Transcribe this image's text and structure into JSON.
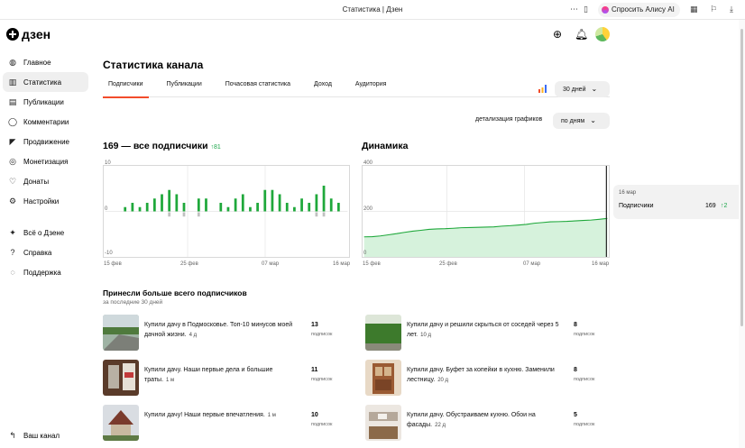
{
  "browser": {
    "tab_title": "Статистика | Дзен",
    "alice_label": "Спросить Алису AI"
  },
  "header": {
    "logo_text": "дзен"
  },
  "sidebar": {
    "items": [
      {
        "label": "Главное",
        "icon": "planet-icon"
      },
      {
        "label": "Статистика",
        "icon": "bars-icon"
      },
      {
        "label": "Публикации",
        "icon": "document-icon"
      },
      {
        "label": "Комментарии",
        "icon": "comment-icon"
      },
      {
        "label": "Продвижение",
        "icon": "megaphone-icon"
      },
      {
        "label": "Монетизация",
        "icon": "coin-icon"
      },
      {
        "label": "Донаты",
        "icon": "heart-hand-icon"
      },
      {
        "label": "Настройки",
        "icon": "gear-icon"
      },
      {
        "label": "Всё о Дзене",
        "icon": "dzen-logo-icon"
      },
      {
        "label": "Справка",
        "icon": "question-icon"
      },
      {
        "label": "Поддержка",
        "icon": "chat-icon"
      }
    ],
    "back_label": "Ваш канал"
  },
  "page": {
    "title": "Статистика канала",
    "tabs": [
      "Подписчики",
      "Публикации",
      "Почасовая статистика",
      "Доход",
      "Аудитория"
    ],
    "period": "30 дней",
    "detail_label": "детализация графиков",
    "detail_value": "по дням"
  },
  "chart_left": {
    "title": "169 — все подписчики",
    "delta": "81",
    "y_ticks": [
      "10",
      "0",
      "-10"
    ],
    "x_ticks": [
      "15 фев",
      "25 фев",
      "07 мар",
      "16 мар"
    ]
  },
  "chart_right": {
    "title": "Динамика",
    "y_ticks": [
      "400",
      "200",
      "0"
    ],
    "x_ticks": [
      "15 фев",
      "25 фев",
      "07 мар",
      "16 мар"
    ]
  },
  "chart_data": [
    {
      "type": "bar",
      "ylim": [
        -10,
        10
      ],
      "x": [
        "15 фев",
        "",
        "",
        "",
        "",
        "",
        "",
        "",
        "",
        "",
        "25 фев",
        "",
        "",
        "",
        "",
        "",
        "",
        "",
        "",
        "",
        "07 мар",
        "",
        "",
        "",
        "",
        "",
        "",
        "",
        "",
        "",
        "16 мар"
      ],
      "series": [
        {
          "color": "#1fa83b",
          "values": [
            0,
            1,
            2,
            1,
            2,
            3,
            4,
            5,
            4,
            2,
            0,
            3,
            3,
            0,
            2,
            1,
            3,
            4,
            1,
            2,
            5,
            5,
            4,
            2,
            1,
            3,
            2,
            4,
            6,
            3,
            2
          ]
        },
        {
          "color": "#c0c0c0",
          "values": [
            0,
            0,
            0,
            0,
            0,
            0,
            0,
            -1,
            0,
            -1,
            0,
            -1,
            0,
            0,
            0,
            0,
            0,
            0,
            0,
            0,
            0,
            0,
            0,
            0,
            0,
            0,
            0,
            -1,
            -1,
            0,
            0
          ]
        }
      ],
      "grid": true
    },
    {
      "type": "area",
      "ylim": [
        0,
        400
      ],
      "x": [
        "15 фев",
        "25 фев",
        "07 мар",
        "16 мар"
      ],
      "series": [
        {
          "color": "#1fa83b",
          "values": [
            88,
            89,
            92,
            97,
            102,
            108,
            113,
            117,
            121,
            123,
            124,
            126,
            128,
            129,
            130,
            131,
            132,
            135,
            137,
            140,
            143,
            148,
            151,
            154,
            155,
            156,
            158,
            160,
            162,
            165,
            169
          ]
        }
      ],
      "grid": true
    }
  ],
  "hover": {
    "date": "16 мар",
    "name": "Подписчики",
    "value": "169",
    "delta": "2"
  },
  "top_section": {
    "title": "Принесли больше всего подписчиков",
    "subtitle": "за последние 30 дней",
    "unit": "подписок",
    "items": [
      {
        "title": "Купили дачу в Подмосковье. Топ-10 минусов моей дачной жизни.",
        "age": "4 д",
        "count": "13"
      },
      {
        "title": "Купили дачу и решили скрыться от соседей через 5 лет.",
        "age": "10 д",
        "count": "8"
      },
      {
        "title": "Купили дачу. Наши первые дела и большие траты.",
        "age": "1 м",
        "count": "11"
      },
      {
        "title": "Купили дачу. Буфет за копейки в кухню. Заменили лестницу.",
        "age": "20 д",
        "count": "8"
      },
      {
        "title": "Купили дачу! Наши первые впечатления.",
        "age": "1 м",
        "count": "10"
      },
      {
        "title": "Купили дачу. Обустраиваем кухню. Обои на фасады.",
        "age": "22 д",
        "count": "5"
      }
    ]
  }
}
